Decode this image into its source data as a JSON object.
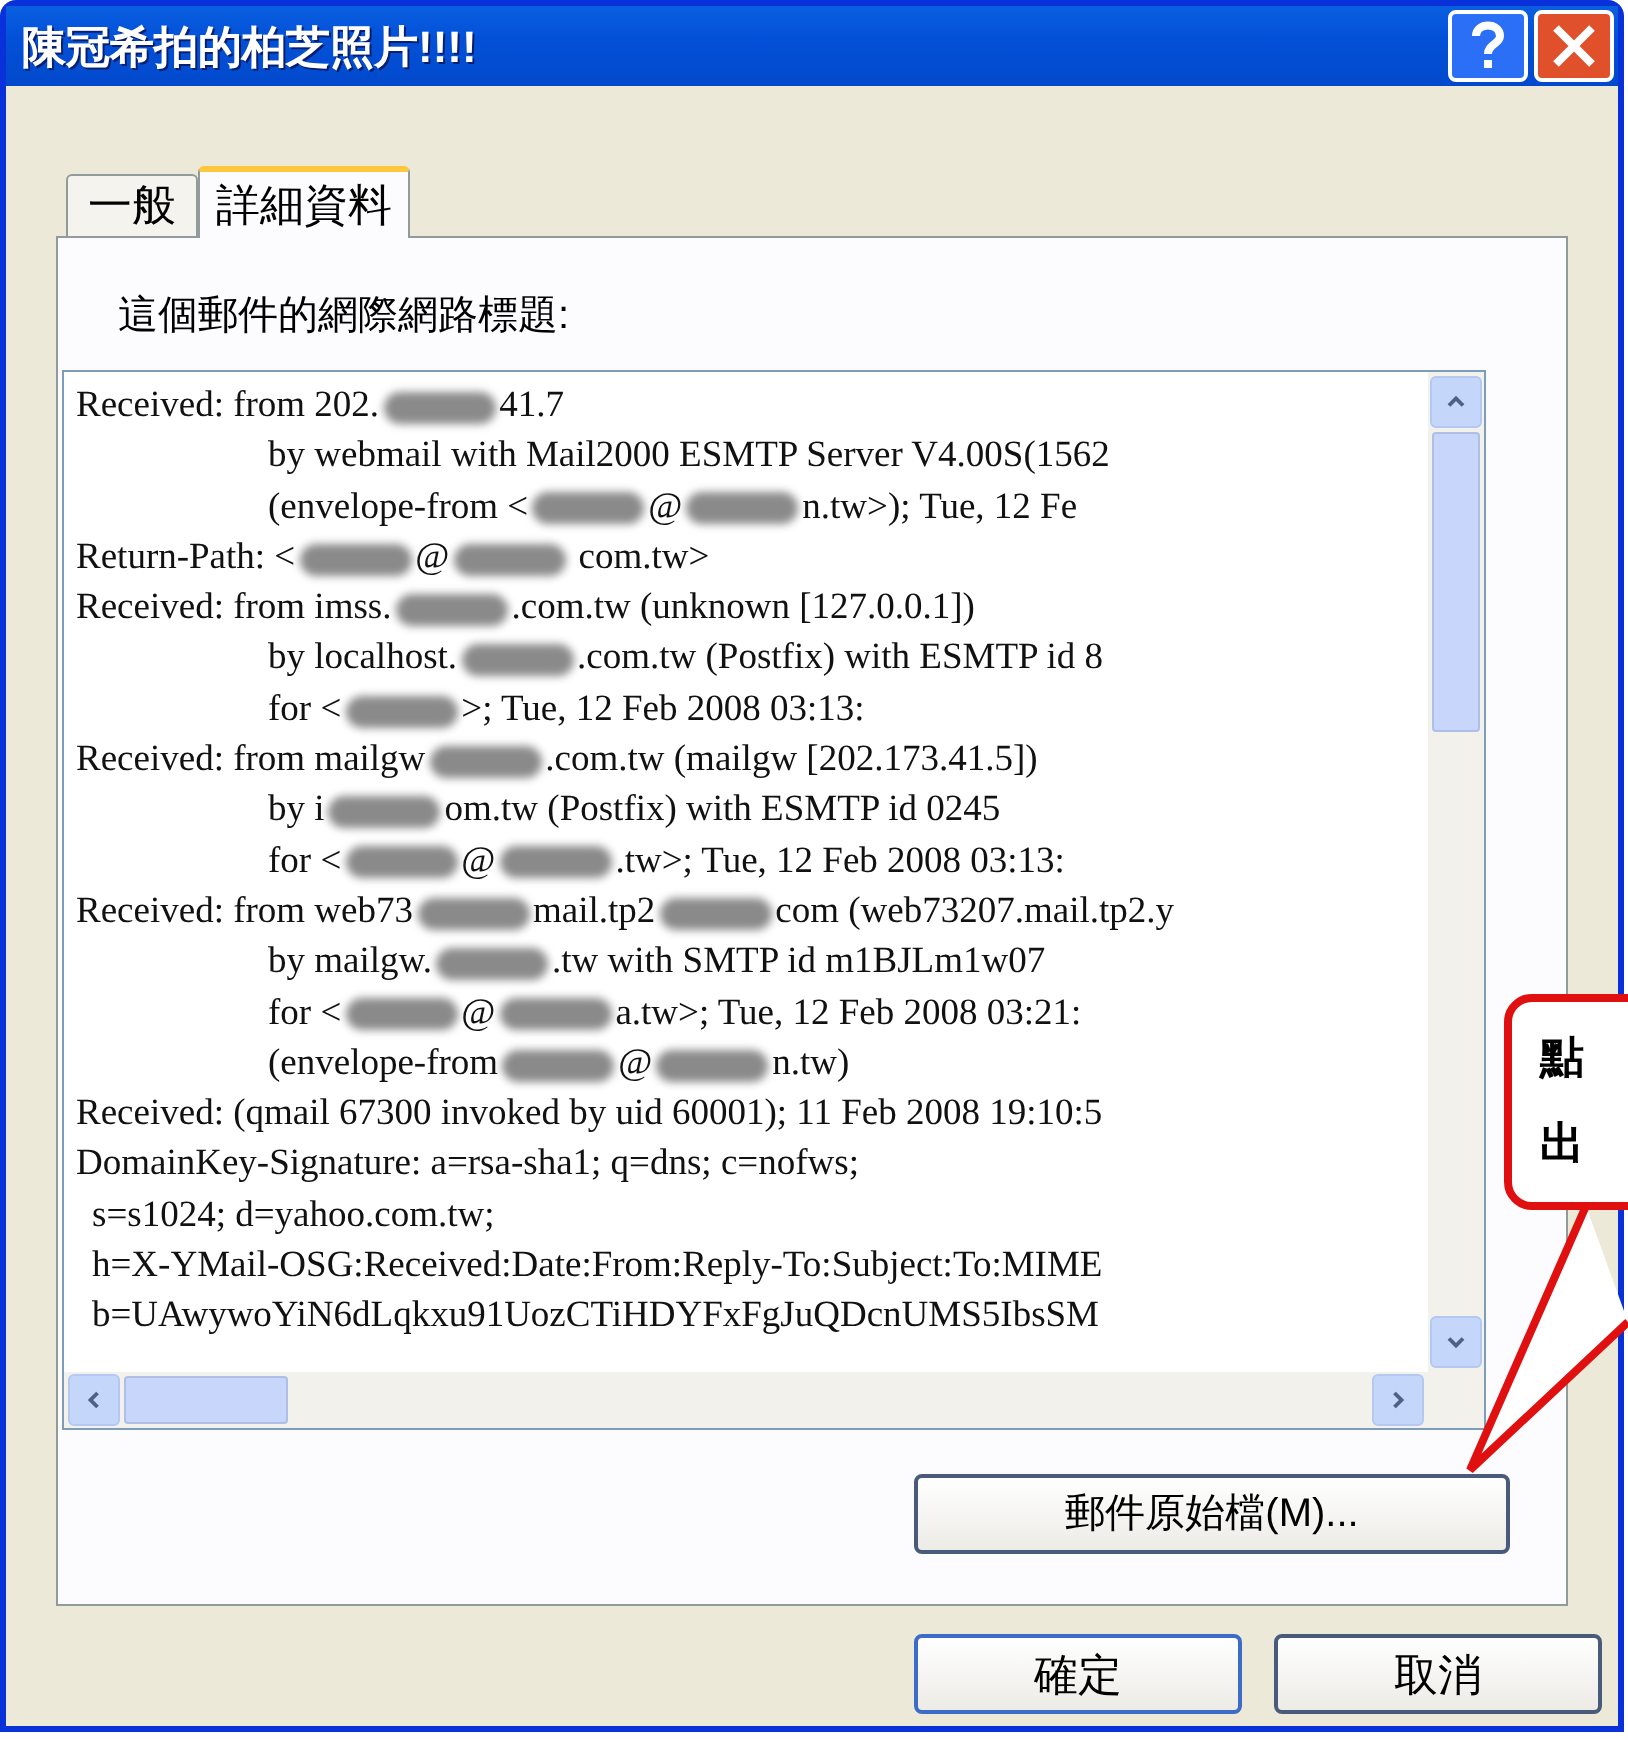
{
  "window": {
    "title": "陳冠希拍的柏芝照片!!!!"
  },
  "tabs": [
    {
      "label": "一般",
      "selected": false
    },
    {
      "label": "詳細資料",
      "selected": true
    }
  ],
  "headers": {
    "label": "這個郵件的網際網路標題:",
    "lines": [
      {
        "kind": "top",
        "segments": [
          {
            "kind": "text",
            "text": "Received: from 202."
          },
          {
            "kind": "redacted"
          },
          {
            "kind": "text",
            "text": "41.7"
          }
        ]
      },
      {
        "kind": "deep",
        "segments": [
          {
            "kind": "text",
            "text": "by webmail with Mail2000 ESMTP Server V4.00S(1562"
          }
        ]
      },
      {
        "kind": "deep",
        "segments": [
          {
            "kind": "text",
            "text": "(envelope-from <"
          },
          {
            "kind": "redacted"
          },
          {
            "kind": "text",
            "text": "@"
          },
          {
            "kind": "redacted"
          },
          {
            "kind": "text",
            "text": "n.tw>); Tue, 12 Fe"
          }
        ]
      },
      {
        "kind": "top",
        "segments": [
          {
            "kind": "text",
            "text": "Return-Path: <"
          },
          {
            "kind": "redacted"
          },
          {
            "kind": "text",
            "text": "@"
          },
          {
            "kind": "redacted"
          },
          {
            "kind": "text",
            "text": " com.tw>"
          }
        ]
      },
      {
        "kind": "top",
        "segments": [
          {
            "kind": "text",
            "text": "Received: from imss."
          },
          {
            "kind": "redacted"
          },
          {
            "kind": "text",
            "text": ".com.tw (unknown [127.0.0.1])"
          }
        ]
      },
      {
        "kind": "deep",
        "segments": [
          {
            "kind": "text",
            "text": "by localhost."
          },
          {
            "kind": "redacted"
          },
          {
            "kind": "text",
            "text": ".com.tw (Postfix) with ESMTP id 8"
          }
        ]
      },
      {
        "kind": "deep",
        "segments": [
          {
            "kind": "text",
            "text": "for <"
          },
          {
            "kind": "redacted"
          },
          {
            "kind": "text",
            "text": ">; Tue, 12 Feb 2008 03:13:"
          }
        ]
      },
      {
        "kind": "top",
        "segments": [
          {
            "kind": "text",
            "text": "Received: from mailgw"
          },
          {
            "kind": "redacted"
          },
          {
            "kind": "text",
            "text": ".com.tw (mailgw [202.173.41.5])"
          }
        ]
      },
      {
        "kind": "deep",
        "segments": [
          {
            "kind": "text",
            "text": "by i"
          },
          {
            "kind": "redacted"
          },
          {
            "kind": "text",
            "text": "om.tw (Postfix) with ESMTP id 0245"
          }
        ]
      },
      {
        "kind": "deep",
        "segments": [
          {
            "kind": "text",
            "text": "for <"
          },
          {
            "kind": "redacted"
          },
          {
            "kind": "text",
            "text": "@"
          },
          {
            "kind": "redacted"
          },
          {
            "kind": "text",
            "text": ".tw>; Tue, 12 Feb 2008 03:13:"
          }
        ]
      },
      {
        "kind": "top",
        "segments": [
          {
            "kind": "text",
            "text": "Received: from web73"
          },
          {
            "kind": "redacted"
          },
          {
            "kind": "text",
            "text": "mail.tp2"
          },
          {
            "kind": "redacted"
          },
          {
            "kind": "text",
            "text": "com (web73207.mail.tp2.y"
          }
        ]
      },
      {
        "kind": "deep",
        "segments": [
          {
            "kind": "text",
            "text": "by mailgw."
          },
          {
            "kind": "redacted"
          },
          {
            "kind": "text",
            "text": ".tw with SMTP id m1BJLm1w07"
          }
        ]
      },
      {
        "kind": "deep",
        "segments": [
          {
            "kind": "text",
            "text": "for <"
          },
          {
            "kind": "redacted"
          },
          {
            "kind": "text",
            "text": "@"
          },
          {
            "kind": "redacted"
          },
          {
            "kind": "text",
            "text": "a.tw>; Tue, 12 Feb 2008 03:21:"
          }
        ]
      },
      {
        "kind": "deep",
        "segments": [
          {
            "kind": "text",
            "text": "(envelope-from"
          },
          {
            "kind": "redacted"
          },
          {
            "kind": "text",
            "text": "@"
          },
          {
            "kind": "redacted"
          },
          {
            "kind": "text",
            "text": "n.tw)"
          }
        ]
      },
      {
        "kind": "top",
        "segments": [
          {
            "kind": "text",
            "text": "Received: (qmail 67300 invoked by uid 60001); 11 Feb 2008 19:10:5"
          }
        ]
      },
      {
        "kind": "top",
        "segments": [
          {
            "kind": "text",
            "text": "DomainKey-Signature: a=rsa-sha1; q=dns; c=nofws;"
          }
        ]
      },
      {
        "kind": "small",
        "segments": [
          {
            "kind": "text",
            "text": "s=s1024; d=yahoo.com.tw;"
          }
        ]
      },
      {
        "kind": "small",
        "segments": [
          {
            "kind": "text",
            "text": "h=X-YMail-OSG:Received:Date:From:Reply-To:Subject:To:MIME"
          }
        ]
      },
      {
        "kind": "small",
        "segments": [
          {
            "kind": "text",
            "text": "b=UAwywoYiN6dLqkxu91UozCTiHDYFxFgJuQDcnUMS5IbsSM"
          }
        ]
      }
    ]
  },
  "source_button": "郵件原始檔(M)...",
  "buttons": [
    "確定",
    "取消"
  ],
  "callout": {
    "lines": [
      "點",
      "出"
    ]
  }
}
